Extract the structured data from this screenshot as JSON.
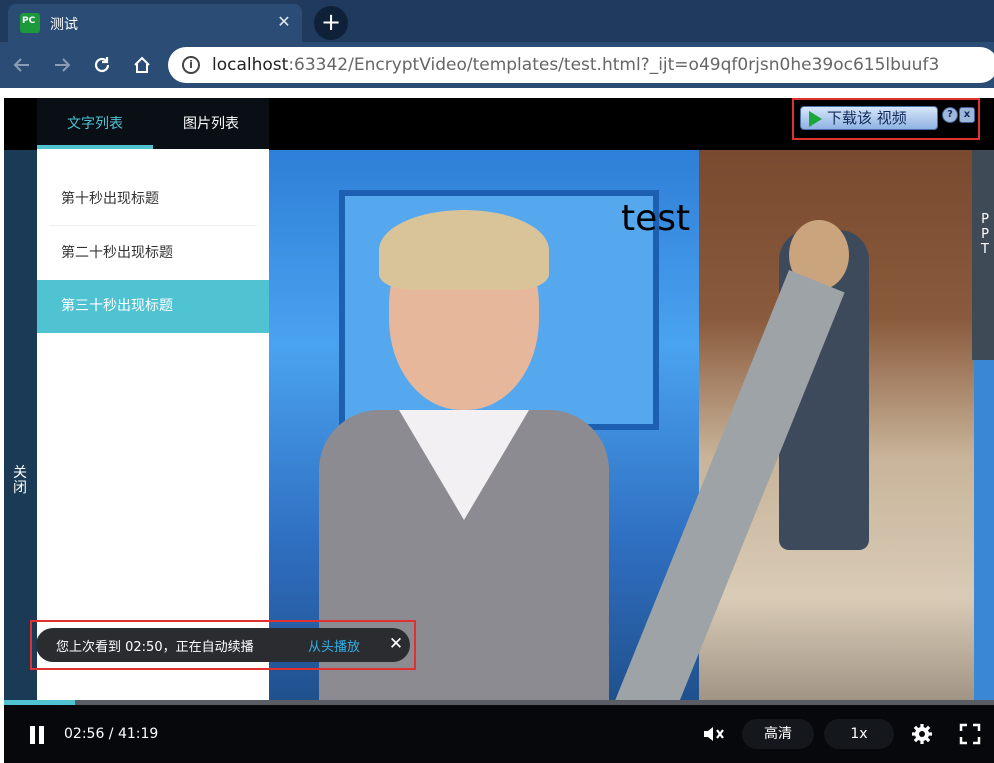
{
  "browser": {
    "tab_title": "测试",
    "tab_close": "✕",
    "new_tab": "+",
    "url_host": "localhost",
    "url_rest": ":63342/EncryptVideo/templates/test.html?_ijt=o49qf0rjsn0he39oc615lbuuf3",
    "info_icon": "i"
  },
  "toolbar": {
    "download_label": "下载该 视频",
    "help_label": "?",
    "close_label": "x"
  },
  "sidebar": {
    "tabs": [
      {
        "label": "文字列表",
        "active": true
      },
      {
        "label": "图片列表",
        "active": false
      }
    ],
    "items": [
      {
        "label": "第十秒出现标题"
      },
      {
        "label": "第二十秒出现标题"
      },
      {
        "label": "第三十秒出现标题",
        "selected": true
      }
    ],
    "close_label": "关闭"
  },
  "ppt_label": "PPT",
  "video": {
    "caption": "test"
  },
  "resume": {
    "message": "您上次看到 02:50，正在自动续播",
    "restart_label": "从头播放",
    "close": "✕"
  },
  "controls": {
    "time_display": "02:56 / 41:19",
    "progress_fraction": 0.0718,
    "quality_label": "高清",
    "speed_label": "1x"
  },
  "colors": {
    "accent": "#4fc3d2",
    "highlight_border": "#e03030",
    "link": "#33b0e8"
  }
}
